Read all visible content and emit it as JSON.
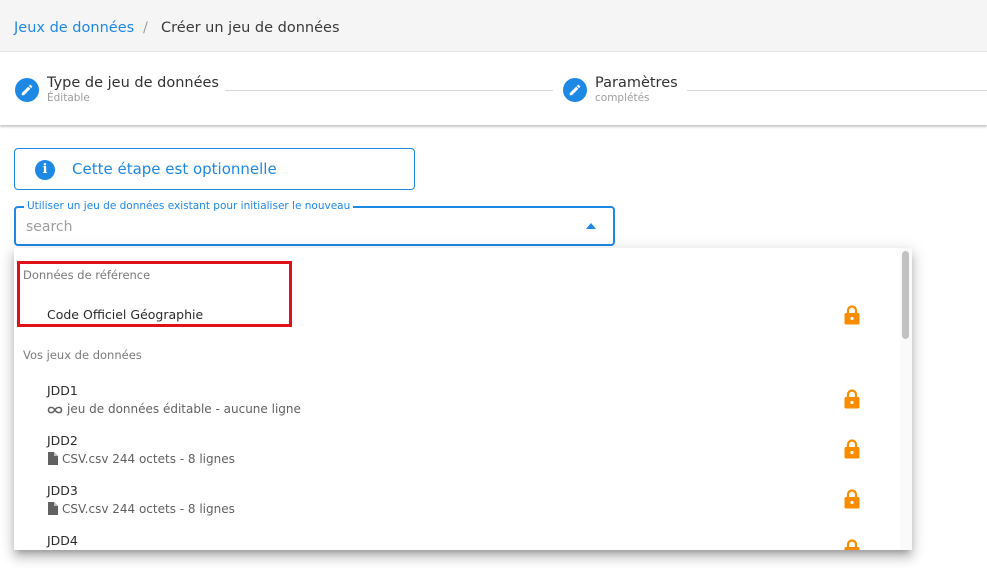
{
  "breadcrumb": {
    "link": "Jeux de données",
    "separator": "/",
    "current": "Créer un jeu de données"
  },
  "stepper": {
    "steps": [
      {
        "title": "Type de jeu de données",
        "subtitle": "Éditable",
        "icon": "pencil-icon"
      },
      {
        "title": "Paramètres",
        "subtitle": "complétés",
        "icon": "pencil-icon"
      }
    ]
  },
  "alert": {
    "icon": "info-icon",
    "text": "Cette étape est optionnelle"
  },
  "select": {
    "label": "Utiliser un jeu de données existant pour initialiser le nouveau",
    "placeholder": "search",
    "value": ""
  },
  "menu": {
    "reference_header": "Données de référence",
    "reference_items": [
      {
        "title": "Code Officiel Géographie",
        "icon": "lock-icon"
      }
    ],
    "datasets_header": "Vos jeux de données",
    "datasets": [
      {
        "title": "JDD1",
        "subtitle": "jeu de données éditable - aucune ligne",
        "sub_icon": "infinity-icon",
        "icon": "lock-icon"
      },
      {
        "title": "JDD2",
        "subtitle": "CSV.csv 244 octets - 8 lignes",
        "sub_icon": "file-icon",
        "icon": "lock-icon"
      },
      {
        "title": "JDD3",
        "subtitle": "CSV.csv 244 octets - 8 lignes",
        "sub_icon": "file-icon",
        "icon": "lock-icon"
      },
      {
        "title": "JDD4",
        "subtitle": "",
        "sub_icon": "",
        "icon": "lock-icon"
      }
    ]
  },
  "colors": {
    "accent": "#1e88e5",
    "lock": "#fb8c00",
    "highlight": "#e0111b"
  }
}
